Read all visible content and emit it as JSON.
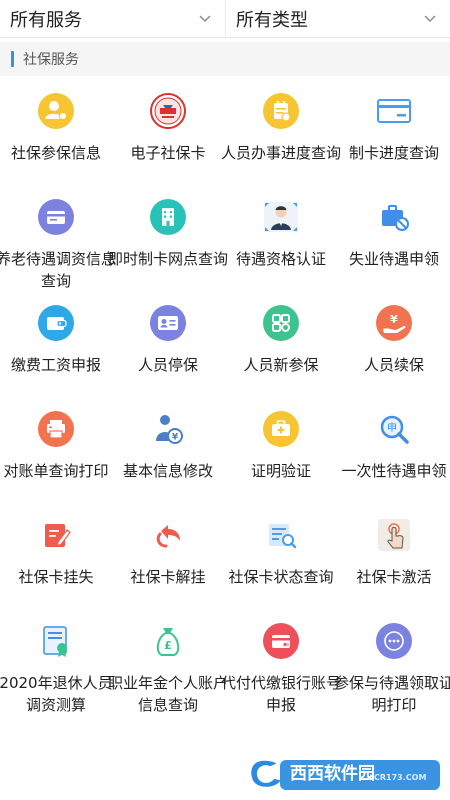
{
  "filters": [
    {
      "label": "所有服务"
    },
    {
      "label": "所有类型"
    }
  ],
  "section": {
    "title": "社保服务"
  },
  "rows": [
    [
      {
        "label": "社保参保信息",
        "icon": "user-badge-icon",
        "color": "#f7c531"
      },
      {
        "label": "电子社保卡",
        "icon": "social-security-emblem-icon",
        "color": "#d9322f"
      },
      {
        "label": "人员办事进度查询",
        "icon": "calendar-progress-icon",
        "color": "#f7c531"
      },
      {
        "label": "制卡进度查询",
        "icon": "card-icon",
        "color": "#4a9de8"
      }
    ],
    [
      {
        "label": "养老待遇调资信息查询",
        "icon": "bank-card-icon",
        "color": "#7b82e0"
      },
      {
        "label": "即时制卡网点查询",
        "icon": "building-icon",
        "color": "#28c2b8"
      },
      {
        "label": "待遇资格认证",
        "icon": "person-photo-icon",
        "color": "#4a7fc8"
      },
      {
        "label": "失业待遇申领",
        "icon": "briefcase-forbidden-icon",
        "color": "#3f8fe8"
      }
    ],
    [
      {
        "label": "缴费工资申报",
        "icon": "wallet-icon",
        "color": "#2fa8e8"
      },
      {
        "label": "人员停保",
        "icon": "id-card-icon",
        "color": "#7b82e0"
      },
      {
        "label": "人员新参保",
        "icon": "apps-grid-icon",
        "color": "#3cc48f"
      },
      {
        "label": "人员续保",
        "icon": "hand-yen-icon",
        "color": "#f2734f"
      }
    ],
    [
      {
        "label": "对账单查询打印",
        "icon": "printer-icon",
        "color": "#f2734f"
      },
      {
        "label": "基本信息修改",
        "icon": "person-yen-icon",
        "color": "#4a7fc8"
      },
      {
        "label": "证明验证",
        "icon": "medical-case-icon",
        "color": "#f7c531"
      },
      {
        "label": "一次性待遇申领",
        "icon": "magnifier-seal-icon",
        "color": "#3f8fe8"
      }
    ],
    [
      {
        "label": "社保卡挂失",
        "icon": "edit-form-icon",
        "color": "#ef5b4f"
      },
      {
        "label": "社保卡解挂",
        "icon": "undo-arrow-icon",
        "color": "#ef5b4f"
      },
      {
        "label": "社保卡状态查询",
        "icon": "document-search-icon",
        "color": "#4a9de8"
      },
      {
        "label": "社保卡激活",
        "icon": "finger-tap-icon",
        "color": "#555555"
      }
    ],
    [
      {
        "label": "2020年退休人员调资测算",
        "icon": "certificate-icon",
        "color": "#3f8fe8"
      },
      {
        "label": "职业年金个人账户信息查询",
        "icon": "money-bag-icon",
        "color": "#3cc48f"
      },
      {
        "label": "代付代缴银行账号申报",
        "icon": "bank-card-round-icon",
        "color": "#ef4f5a"
      },
      {
        "label": "参保与待遇领取证明打印",
        "icon": "more-icon",
        "color": "#7b82e0"
      }
    ]
  ],
  "watermark": {
    "brand": "西西软件园",
    "site": "CR173.COM",
    "accent": "#2a8be0"
  }
}
